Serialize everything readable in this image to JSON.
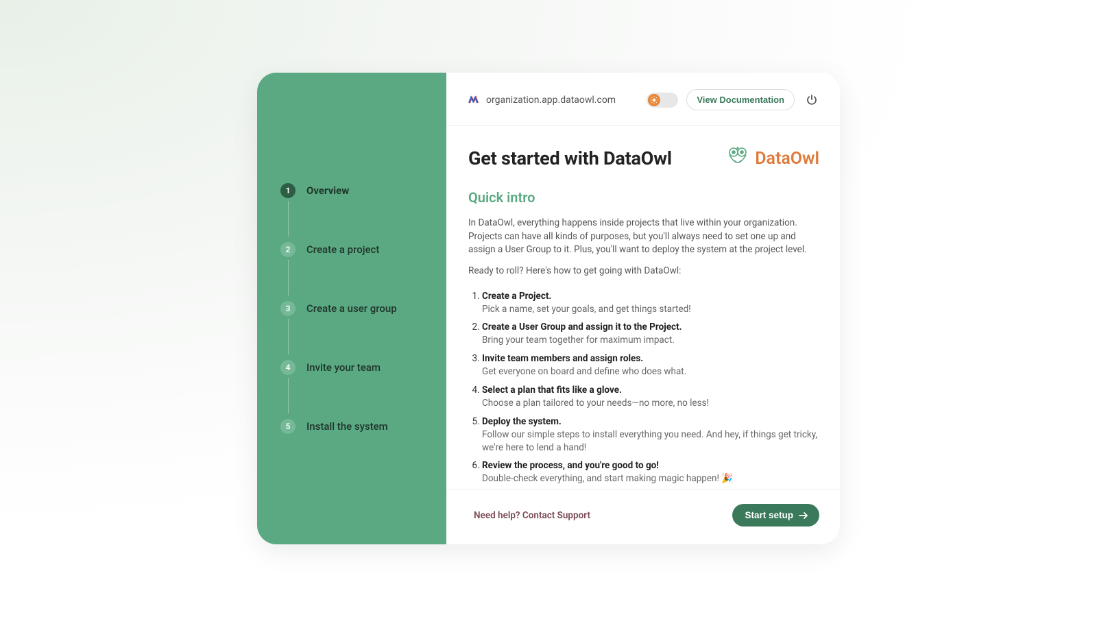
{
  "topbar": {
    "url": "organization.app.dataowl.com",
    "view_doc_label": "View Documentation"
  },
  "sidebar": {
    "steps": [
      {
        "num": "1",
        "label": "Overview",
        "active": true
      },
      {
        "num": "2",
        "label": "Create a project",
        "active": false
      },
      {
        "num": "3",
        "label": "Create a user group",
        "active": false
      },
      {
        "num": "4",
        "label": "Invite your team",
        "active": false
      },
      {
        "num": "5",
        "label": "Install the system",
        "active": false
      }
    ]
  },
  "content": {
    "title": "Get started with DataOwl",
    "brand": "DataOwl",
    "subheading": "Quick intro",
    "intro": "In DataOwl, everything happens inside projects that live within your organization. Projects can have all kinds of purposes, but you'll always need to set one up and assign a User Group to it. Plus, you'll want to deploy the system at the project level.",
    "ready": "Ready to roll? Here's how to get going with DataOwl:",
    "tasks": [
      {
        "title": "Create a Project.",
        "desc": "Pick a name, set your goals, and get things started!"
      },
      {
        "title": "Create a User Group and assign it to the Project.",
        "desc": "Bring your team together for maximum impact."
      },
      {
        "title": "Invite team members and assign roles.",
        "desc": "Get everyone on board and define who does what."
      },
      {
        "title": "Select a plan that fits like a glove.",
        "desc": "Choose a plan tailored to your needs—no more, no less!"
      },
      {
        "title": "Deploy the system.",
        "desc": "Follow our simple steps to install everything you need. And hey, if things get tricky, we're here to lend a hand!"
      },
      {
        "title": "Review the process, and you're good to go!",
        "desc": "Double-check everything, and start making magic happen! 🎉"
      }
    ]
  },
  "footer": {
    "support": "Need help? Contact Support",
    "start_label": "Start setup"
  },
  "colors": {
    "sidebar_bg": "#5aa982",
    "accent": "#3a7a5b",
    "brand": "#e07a3a"
  }
}
